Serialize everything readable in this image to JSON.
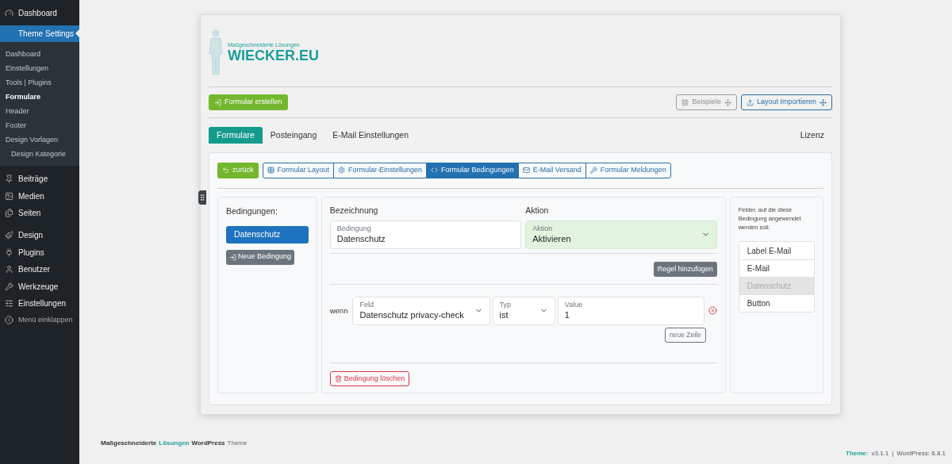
{
  "sidebar": {
    "top": {
      "label": "Dashboard"
    },
    "section": {
      "label": "Theme Settings",
      "selected": true
    },
    "submenu": [
      {
        "label": "Dashboard",
        "selected": false
      },
      {
        "label": "Einstellungen",
        "selected": false
      },
      {
        "label": "Tools | Plugins",
        "selected": false
      },
      {
        "label": "Formulare",
        "selected": true
      },
      {
        "label": "Header",
        "selected": false
      },
      {
        "label": "Footer",
        "selected": false
      },
      {
        "label": "Design Vorlagen",
        "selected": false,
        "children": [
          {
            "label": "Design Kategorie",
            "selected": false
          }
        ]
      }
    ],
    "menu": [
      {
        "label": "Beiträge"
      },
      {
        "label": "Medien"
      },
      {
        "label": "Seiten"
      },
      {
        "label": "Design"
      },
      {
        "label": "Plugins"
      },
      {
        "label": "Benutzer"
      },
      {
        "label": "Werkzeuge"
      },
      {
        "label": "Einstellungen"
      }
    ],
    "collapse": {
      "label": "Menü einklappen"
    }
  },
  "logo": {
    "tagline": "Maßgeschneiderte Lösungen",
    "name": "WIECKER.EU"
  },
  "toolbar": {
    "create": "Formular erstellen",
    "right": [
      {
        "label": "Beispiele",
        "disabled": true
      },
      {
        "label": "Layout Importieren",
        "disabled": false
      }
    ]
  },
  "tabs": [
    {
      "label": "Formulare",
      "selected": true
    },
    {
      "label": "Posteingang",
      "selected": false
    },
    {
      "label": "E-Mail Einstellungen",
      "selected": false
    }
  ],
  "license_tab": {
    "label": "Lizenz"
  },
  "back_button": "zurück",
  "steps": [
    {
      "label": "Formular Layout",
      "selected": false
    },
    {
      "label": "Formular-Einstellungen",
      "selected": false
    },
    {
      "label": "Formular Bedingungen",
      "selected": true
    },
    {
      "label": "E-Mail Versand",
      "selected": false
    },
    {
      "label": "Formular Meldungen",
      "selected": false
    }
  ],
  "conditions": {
    "heading": "Bedingungen:",
    "items": [
      {
        "label": "Datenschutz",
        "selected": true
      }
    ],
    "new_button": "Neue Bedingung"
  },
  "editor": {
    "name_heading": "Bezeichnung",
    "action_heading": "Aktion",
    "name_field": {
      "label": "Bedingung",
      "value": "Datenschutz"
    },
    "action_field": {
      "label": "Aktion",
      "value": "Aktivieren"
    },
    "add_rule": "Regel hinzufügen",
    "rule": {
      "prefix": "wenn",
      "field": {
        "label": "Feld",
        "value": "Datenschutz privacy-check"
      },
      "type": {
        "label": "Typ",
        "value": "ist"
      },
      "value": {
        "label": "Value",
        "value": "1"
      }
    },
    "new_row": "neue Zeile",
    "delete": "Bedingung löschen"
  },
  "targets": {
    "hint": "Felder, auf die diese Bedingung angewendet werden soll.",
    "items": [
      {
        "label": "Label E-Mail",
        "disabled": false
      },
      {
        "label": "E-Mail",
        "disabled": false
      },
      {
        "label": "Datenschutz",
        "disabled": true
      },
      {
        "label": "Button",
        "disabled": false
      }
    ]
  },
  "footer": {
    "credit": [
      {
        "text": "Maßgeschneiderte",
        "kind": "bold"
      },
      {
        "text": "Lösungen",
        "kind": "accent"
      },
      {
        "text": "WordPress",
        "kind": "bold"
      },
      {
        "text": "Theme",
        "kind": "plain"
      }
    ],
    "theme_label": "Theme:",
    "theme_version": "v3.1.1",
    "separator": "|",
    "wp_version": "WordPress: 6.8.1"
  }
}
